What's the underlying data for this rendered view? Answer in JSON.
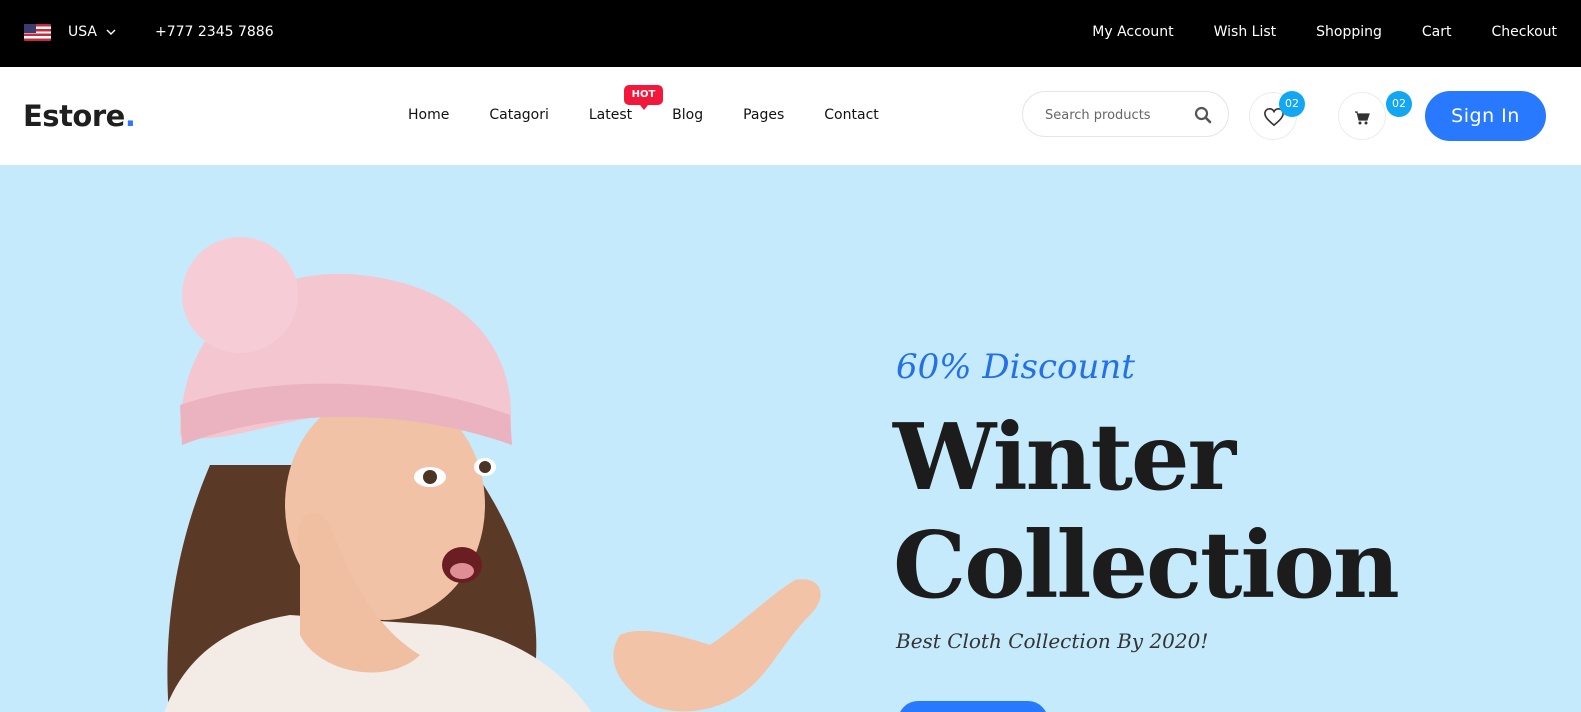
{
  "topbar": {
    "country": "USA",
    "phone": "+777 2345 7886",
    "links": [
      "My Account",
      "Wish List",
      "Shopping",
      "Cart",
      "Checkout"
    ]
  },
  "header": {
    "logo_text": "Estore",
    "logo_dot": ".",
    "nav": [
      "Home",
      "Catagori",
      "Latest",
      "Blog",
      "Pages",
      "Contact"
    ],
    "hot_badge": "HOT",
    "search_placeholder": "Search products",
    "wishlist_count": "02",
    "cart_count": "02",
    "signin_label": "Sign In"
  },
  "hero": {
    "discount": "60% Discount",
    "title_line1": "Winter",
    "title_line2": "Collection",
    "tagline": "Best Cloth Collection By 2020!"
  },
  "colors": {
    "accent": "#2979ff",
    "hot": "#f2173b",
    "badge": "#13a6f3",
    "hero_bg": "#c5eafc"
  },
  "icons": [
    "us-flag-icon",
    "chevron-down-icon",
    "search-icon",
    "heart-icon",
    "cart-icon"
  ]
}
